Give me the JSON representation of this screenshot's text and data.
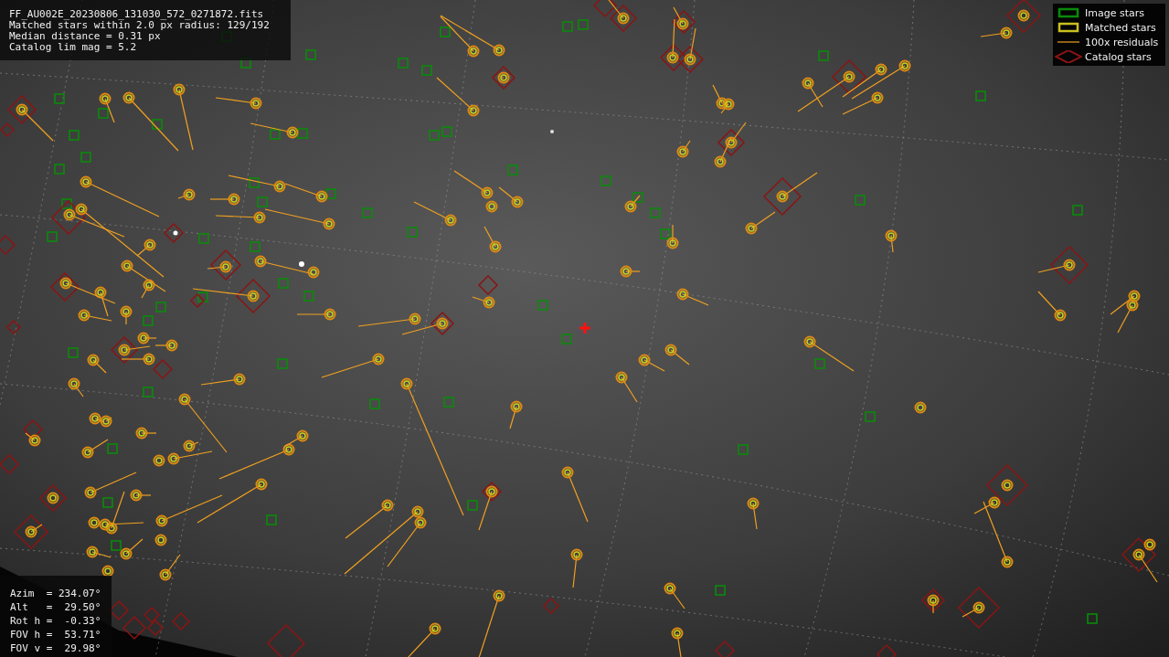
{
  "info_box": {
    "lines": [
      "FF_AU002E_20230806_131030_572_0271872.fits",
      "Matched stars within 2.0 px radius: 129/192",
      "Median distance = 0.31 px",
      "Catalog lim mag = 5.2"
    ]
  },
  "legend": {
    "items": [
      {
        "kind": "image",
        "label": "Image stars"
      },
      {
        "kind": "matched",
        "label": "Matched stars"
      },
      {
        "kind": "residual",
        "label": "100x residuals"
      },
      {
        "kind": "catalog",
        "label": "Catalog stars"
      }
    ]
  },
  "pointing_box": {
    "lines": [
      "Azim  = 234.07°",
      "Alt   =  29.50°",
      "Rot h =  -0.33°",
      "FOV h =  53.71°",
      "FOV v =  29.98°"
    ]
  }
}
